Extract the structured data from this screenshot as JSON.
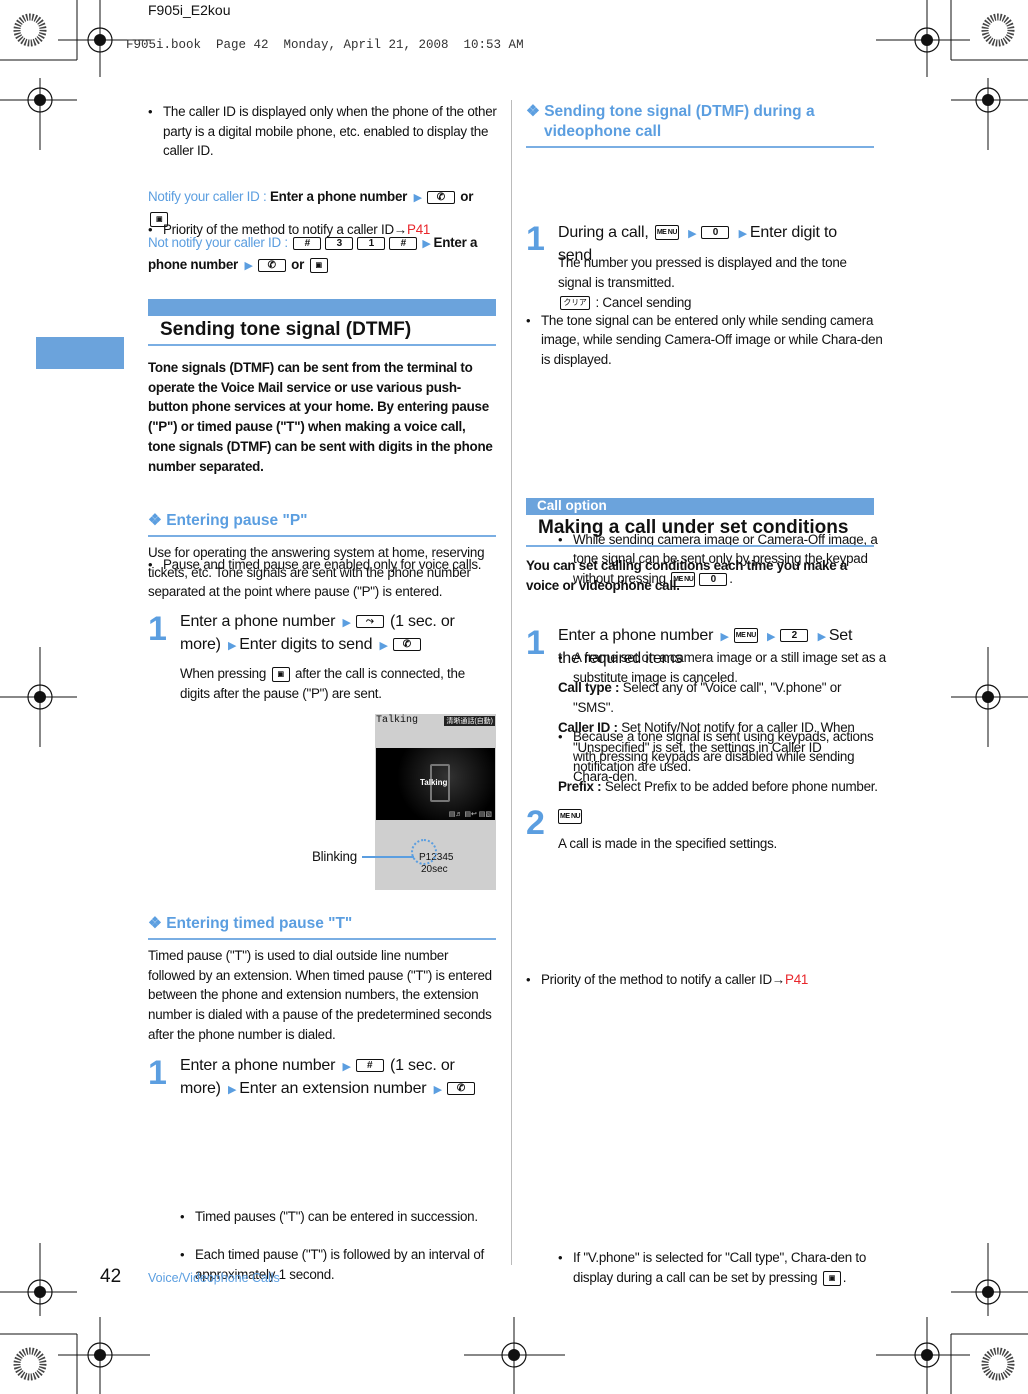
{
  "header": {
    "file_title": "F905i_E2kou",
    "print_line": "F905i.book  Page 42  Monday, April 21, 2008  10:53 AM"
  },
  "colors": {
    "accent": "#5b9ee0",
    "bar": "#6ba3dc",
    "link": "#e8262b"
  },
  "keys": {
    "send": "✆",
    "videophone": "▣",
    "hash": "#",
    "three": "3",
    "one": "1",
    "pause": "⤳",
    "menu": "ME NU",
    "zero": "0",
    "two": "2",
    "clear": "クリア"
  },
  "left": {
    "blocks": [
      [
        "The caller ID is displayed only when the phone of the other party is a digital mobile phone, etc. enabled to display the caller ID."
      ],
      [
        "Priority of the method to notify a caller ID→",
        {
          "c": "red",
          "t": "P41"
        }
      ],
      [
        {
          "c": "blue",
          "t": "Notify your caller ID : "
        },
        {
          "b": 1,
          "t": "Enter a phone number "
        },
        {
          "a": 1
        },
        {
          "k": "send"
        },
        {
          "b": 1,
          "t": " or "
        },
        {
          "k": "videophone",
          "sq": 1
        }
      ],
      [
        {
          "c": "blue",
          "t": "Not notify your caller ID : "
        },
        {
          "k": "hash"
        },
        {
          "k": "three"
        },
        {
          "k": "one"
        },
        {
          "k": "hash"
        },
        {
          "a": 1
        },
        {
          "b": 1,
          "t": "Enter a phone number "
        },
        {
          "a": 1
        },
        {
          "k": "send"
        },
        {
          "b": 1,
          "t": " or "
        },
        {
          "k": "videophone",
          "sq": 1
        }
      ],
      [
        {
          "b": 1,
          "t": "Tone signals (DTMF) can be sent from the terminal to operate the Voice Mail service or use various push-button phone services at your home. By entering pause (\"P\") or timed pause (\"T\") when making a voice call, tone signals (DTMF) can be sent with digits in the phone number separated."
        }
      ],
      [
        "Pause and timed pause are enabled only for voice calls."
      ],
      [
        "Use for operating the answering system at home, reserving tickets, etc. Tone signals are sent with the phone number separated at the point where pause (\"P\") is entered."
      ],
      [
        "Enter a phone number ",
        {
          "a": 1
        },
        {
          "k": "pause"
        },
        " (1 sec. or more) ",
        {
          "a": 1
        },
        "Enter digits to send ",
        {
          "a": 1
        },
        {
          "k": "send"
        }
      ],
      [
        "When pressing ",
        {
          "k": "videophone",
          "sq": 1
        },
        " after the call is connected, the digits after the pause (\"P\") are sent."
      ],
      [
        "Timed pause (\"T\") is used to dial outside line number followed by an extension. When timed pause (\"T\") is entered between the phone and extension numbers, the extension number is dialed with a pause of the predetermined seconds after the phone number is dialed."
      ],
      [
        "Enter a phone number ",
        {
          "a": 1
        },
        {
          "k": "hash"
        },
        " (1 sec. or more) ",
        {
          "a": 1
        },
        "Enter an extension number ",
        {
          "a": 1
        },
        {
          "k": "send"
        }
      ],
      [
        "Timed pauses (\"T\") can be entered in succession."
      ],
      [
        "Each timed pause (\"T\") is followed by an interval of approximately 1 second."
      ]
    ],
    "section_title": "Sending tone signal (DTMF)",
    "subhead_pause": "❖ Entering pause \"P\"",
    "subhead_timed": "❖ Entering timed pause \"T\"",
    "step_num": "1",
    "figure": {
      "screen_title": "Talking",
      "screen_badge": "清晰通話(自動)",
      "video_label": "Talking",
      "number": "P12345",
      "timer": "20sec",
      "callout": "Blinking"
    }
  },
  "right": {
    "subhead_dtmf": "❖ Sending tone signal (DTMF) during a videophone call",
    "blocks": [
      [
        "The tone signal can be entered only while sending camera image, while sending Camera-Off image or while Chara-den is displayed."
      ],
      [
        "During a call, ",
        {
          "k": "menu",
          "sq": 1
        },
        " ",
        {
          "a": 1
        },
        {
          "k": "zero"
        },
        " ",
        {
          "a": 1
        },
        "Enter digit to send"
      ],
      [
        "The number you pressed is displayed and the tone signal is transmitted."
      ],
      [
        {
          "k": "clear",
          "kana": 1
        },
        " : Cancel sending"
      ],
      [
        "While sending camera image or Camera-Off image, a tone signal can be sent only by pressing the keypad without pressing ",
        {
          "k": "menu",
          "sq": 1
        },
        {
          "k": "zero"
        },
        "."
      ],
      [
        "A frame set on a camera image or a still image set as a substitute image is canceled."
      ],
      [
        "Because a tone signal is sent using keypads, actions with pressing keypads are disabled while sending Chara-den."
      ],
      [
        {
          "b": 1,
          "t": "You can set calling conditions each time you make a voice or videophone call."
        }
      ],
      [
        "Priority of the method to notify a caller ID→",
        {
          "c": "red",
          "t": "P41"
        }
      ],
      [
        "Enter a phone number ",
        {
          "a": 1
        },
        {
          "k": "menu",
          "sq": 1
        },
        " ",
        {
          "a": 1
        },
        {
          "k": "two"
        },
        " ",
        {
          "a": 1
        },
        "Set the required items"
      ],
      [
        {
          "b": 1,
          "t": "Call type : "
        },
        "Select any of \"Voice call\", \"V.phone\" or \"SMS\"."
      ],
      [
        {
          "b": 1,
          "t": "Caller ID : "
        },
        "Set Notify/Not notify for a caller ID. When \"Unspecified\" is set, the settings in Caller ID notification are used."
      ],
      [
        {
          "b": 1,
          "t": "Prefix : "
        },
        "Select Prefix to be added before phone number."
      ],
      [
        {
          "k": "menu",
          "sq": 1
        }
      ],
      [
        "A call is made in the specified settings."
      ],
      [
        "If \"V.phone\" is selected for \"Call type\", Chara-den to display during a call can be set by pressing ",
        {
          "k": "videophone",
          "sq": 1
        },
        "."
      ]
    ],
    "category_label": "Call option",
    "section_title": "Making a call under set conditions",
    "step_num_1": "1",
    "step_num_2": "2"
  },
  "footer": {
    "page_number": "42",
    "chapter": "Voice/Videophone Calls"
  }
}
